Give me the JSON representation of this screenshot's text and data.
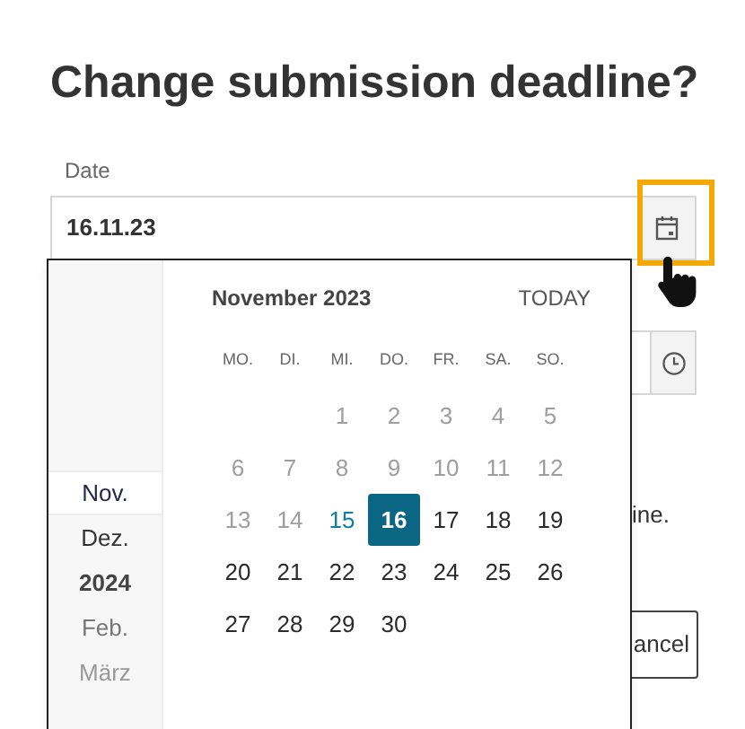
{
  "title": "Change submission deadline?",
  "date_field": {
    "label": "Date",
    "value": "16.11.23"
  },
  "note_fragment": "ine.",
  "cancel_button_fragment": "ancel",
  "picker": {
    "months": [
      {
        "label": "Nov.",
        "kind": "month",
        "selected": true
      },
      {
        "label": "Dez.",
        "kind": "month",
        "selected": false
      },
      {
        "label": "2024",
        "kind": "year",
        "selected": false
      },
      {
        "label": "Feb.",
        "kind": "month",
        "selected": false
      },
      {
        "label": "März",
        "kind": "month",
        "selected": false
      }
    ],
    "month_title": "November 2023",
    "today_button": "TODAY",
    "weekdays": [
      "MO.",
      "DI.",
      "MI.",
      "DO.",
      "FR.",
      "SA.",
      "SO."
    ],
    "weeks": [
      [
        {
          "label": "1",
          "kind": "past",
          "selected": false
        },
        {
          "label": "2",
          "kind": "past",
          "selected": false
        },
        {
          "label": "3",
          "kind": "past",
          "selected": false
        },
        {
          "label": "4",
          "kind": "past",
          "selected": false
        },
        {
          "label": "5",
          "kind": "past",
          "selected": false
        }
      ],
      [
        {
          "label": "6",
          "kind": "past",
          "selected": false
        },
        {
          "label": "7",
          "kind": "past",
          "selected": false
        },
        {
          "label": "8",
          "kind": "past",
          "selected": false
        },
        {
          "label": "9",
          "kind": "past",
          "selected": false
        },
        {
          "label": "10",
          "kind": "past",
          "selected": false
        },
        {
          "label": "11",
          "kind": "past",
          "selected": false
        },
        {
          "label": "12",
          "kind": "past",
          "selected": false
        }
      ],
      [
        {
          "label": "13",
          "kind": "past",
          "selected": false
        },
        {
          "label": "14",
          "kind": "past",
          "selected": false
        },
        {
          "label": "15",
          "kind": "today",
          "selected": false
        },
        {
          "label": "16",
          "kind": "future",
          "selected": true
        },
        {
          "label": "17",
          "kind": "future",
          "selected": false
        },
        {
          "label": "18",
          "kind": "future",
          "selected": false
        },
        {
          "label": "19",
          "kind": "future",
          "selected": false
        }
      ],
      [
        {
          "label": "20",
          "kind": "future",
          "selected": false
        },
        {
          "label": "21",
          "kind": "future",
          "selected": false
        },
        {
          "label": "22",
          "kind": "future",
          "selected": false
        },
        {
          "label": "23",
          "kind": "future",
          "selected": false
        },
        {
          "label": "24",
          "kind": "future",
          "selected": false
        },
        {
          "label": "25",
          "kind": "future",
          "selected": false
        },
        {
          "label": "26",
          "kind": "future",
          "selected": false
        }
      ],
      [
        {
          "label": "27",
          "kind": "future",
          "selected": false
        },
        {
          "label": "28",
          "kind": "future",
          "selected": false
        },
        {
          "label": "29",
          "kind": "future",
          "selected": false
        },
        {
          "label": "30",
          "kind": "future",
          "selected": false
        }
      ]
    ]
  }
}
